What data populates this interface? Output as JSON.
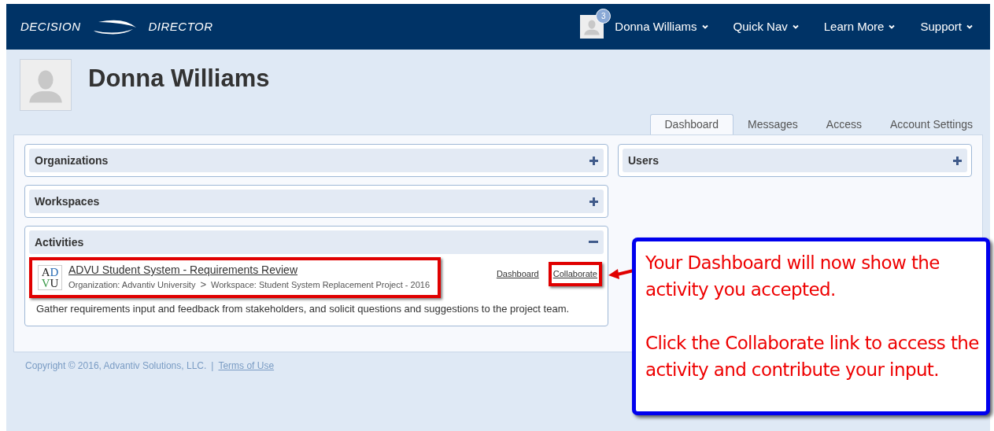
{
  "navbar": {
    "brand_left": "DECISION",
    "brand_right": "DIRECTOR",
    "notification_count": "3",
    "menus": [
      "Donna Williams",
      "Quick Nav",
      "Learn More",
      "Support"
    ]
  },
  "profile": {
    "name": "Donna Williams"
  },
  "tabs": [
    {
      "label": "Dashboard",
      "selected": true
    },
    {
      "label": "Messages",
      "selected": false
    },
    {
      "label": "Access",
      "selected": false
    },
    {
      "label": "Account Settings",
      "selected": false
    }
  ],
  "left_panels": [
    {
      "title": "Organizations",
      "expanded": false
    },
    {
      "title": "Workspaces",
      "expanded": false
    },
    {
      "title": "Activities",
      "expanded": true,
      "activity": {
        "logo": [
          "AD",
          "VU"
        ],
        "title": "ADVU Student System - Requirements Review",
        "organization": "Organization: Advantiv University",
        "separator": ">",
        "workspace": "Workspace: Student System Replacement Project - 2016",
        "links": [
          {
            "label": "Dashboard",
            "highlighted": false
          },
          {
            "label": "Collaborate",
            "highlighted": true
          }
        ],
        "highlighted": true,
        "description": "Gather requirements input and feedback from stakeholders, and solicit questions and suggestions to the project team."
      }
    }
  ],
  "right_panels": [
    {
      "title": "Users",
      "expanded": false
    }
  ],
  "footer": {
    "copyright": "Copyright © 2016, Advantiv Solutions, LLC.",
    "divider": "|",
    "link": "Terms of Use"
  },
  "callout": {
    "paragraphs": [
      "Your Dashboard will now show the activity you accepted.",
      "Click the Collaborate link to access the activity and contribute your input."
    ]
  }
}
